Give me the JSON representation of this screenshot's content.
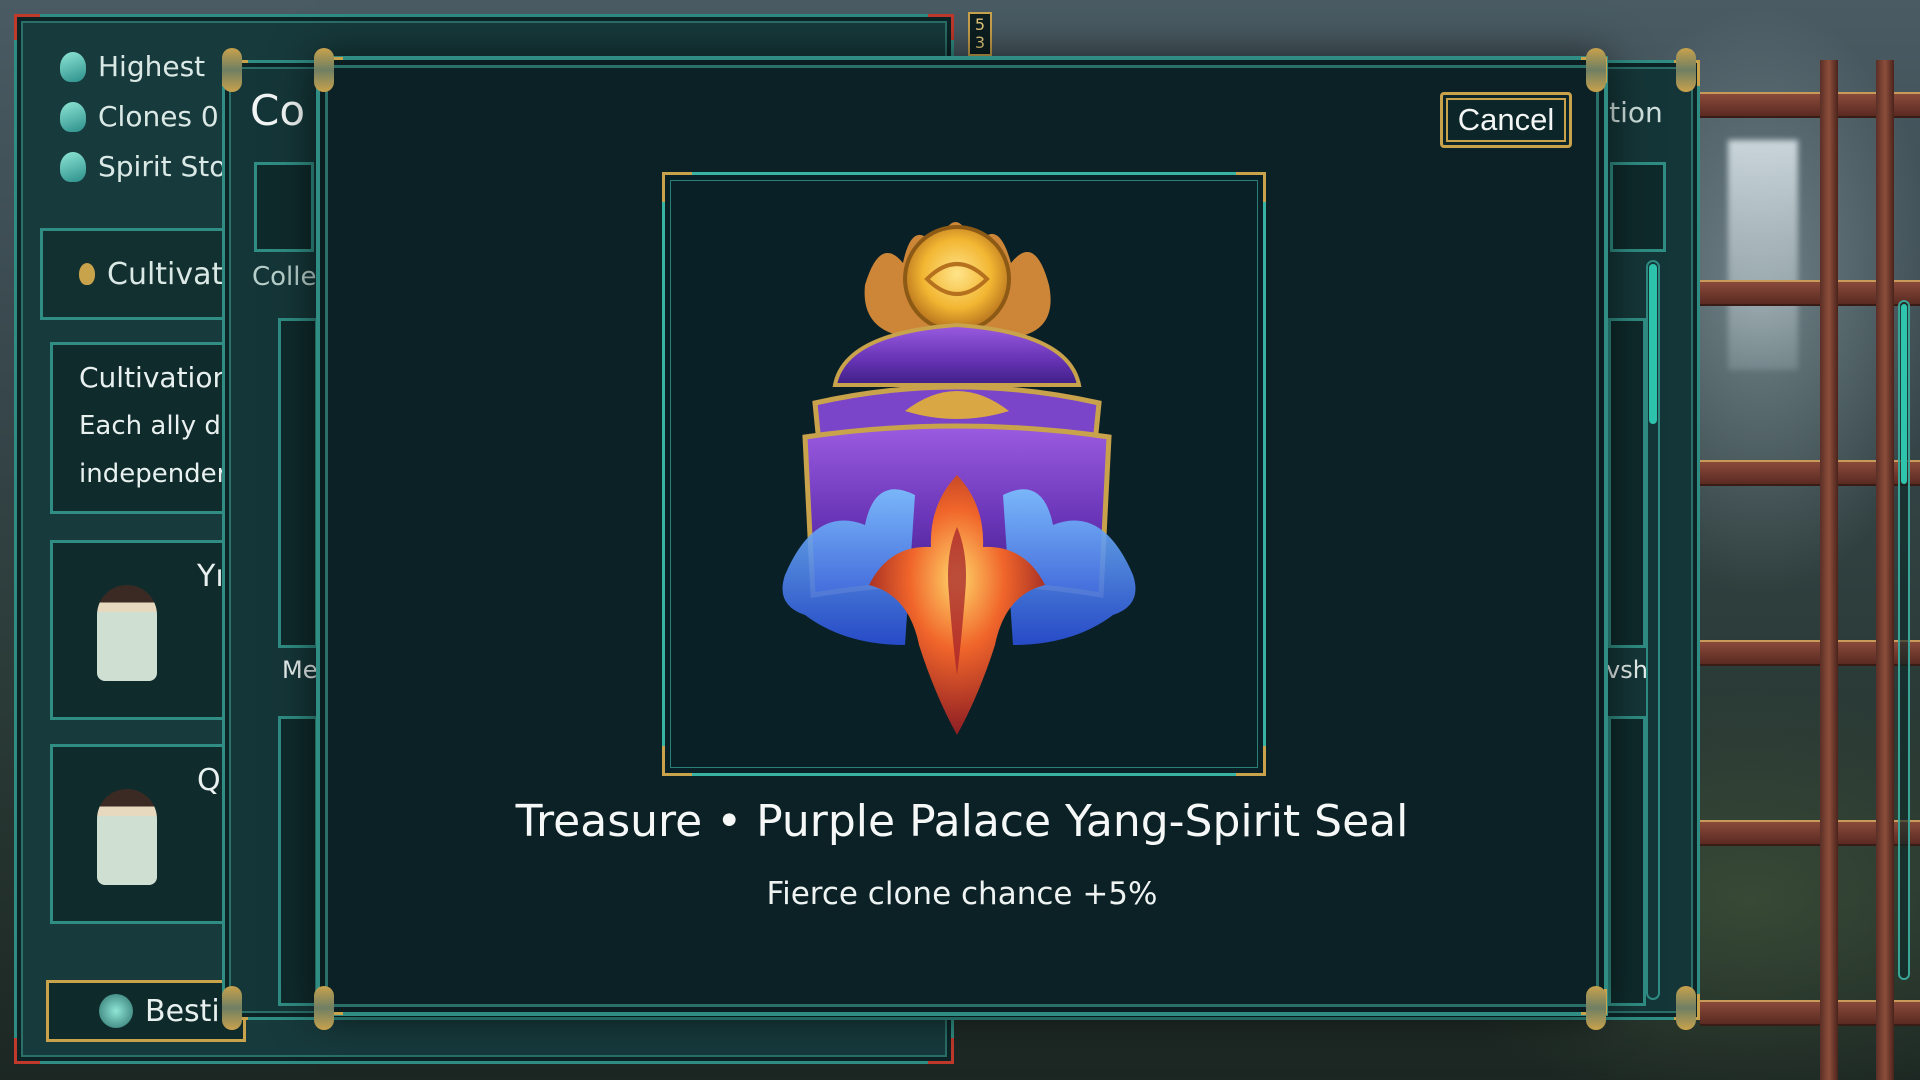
{
  "left_panel": {
    "stats": [
      {
        "label": "Highest",
        "icon": "figure-icon"
      },
      {
        "label": "Clones 0",
        "icon": "clones-icon"
      },
      {
        "label": "Spirit Sto",
        "icon": "spirit-stone-icon"
      }
    ],
    "tab_label": "Cultivat",
    "info_card": {
      "title": "Cultivation",
      "line1": "Each ally d",
      "line2": "independer"
    },
    "character_cards": [
      {
        "initial": "Yı"
      },
      {
        "initial": "Q"
      }
    ],
    "bestiary_label": "Besti",
    "badge": "5\n3"
  },
  "mid_panel": {
    "title": "Co",
    "subtitle": "Colle",
    "right_text": "otion",
    "tag_left": "Me",
    "tag_right": "vsh"
  },
  "modal": {
    "cancel_label": "Cancel",
    "item_title": "Treasure • Purple Palace Yang-Spirit Seal",
    "item_desc": "Fierce clone chance +5%",
    "item_icon": "purple-palace-seal-icon"
  },
  "colors": {
    "teal_border": "#2f8d83",
    "gold_accent": "#c9a24c",
    "modal_bg": "#0b2126",
    "seal_purple": "#7a3fc4",
    "seal_gold": "#f2b632"
  }
}
